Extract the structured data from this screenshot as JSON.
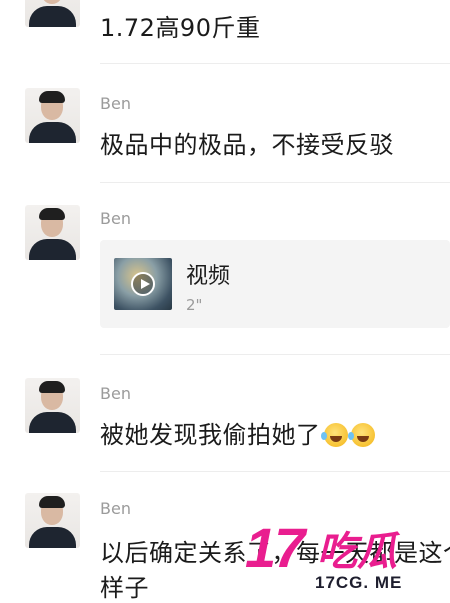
{
  "chat": {
    "messages": [
      {
        "sender": "",
        "text": "1.72高90斤重"
      },
      {
        "sender": "Ben",
        "text": "极品中的极品，不接受反驳"
      },
      {
        "sender": "Ben",
        "video": {
          "title": "视频",
          "duration": "2\""
        }
      },
      {
        "sender": "Ben",
        "text": "被她发现我偷拍她了",
        "emojis": [
          "crying-laughing-emoji",
          "crying-laughing-emoji"
        ]
      },
      {
        "sender": "Ben",
        "text_line1": "以后确定关系了，每一天都是这个",
        "text_line2": "样子"
      }
    ]
  },
  "watermark": {
    "big": "17",
    "cn": "吃瓜",
    "url": "17CG. ME",
    "color": "#e91e8f"
  }
}
